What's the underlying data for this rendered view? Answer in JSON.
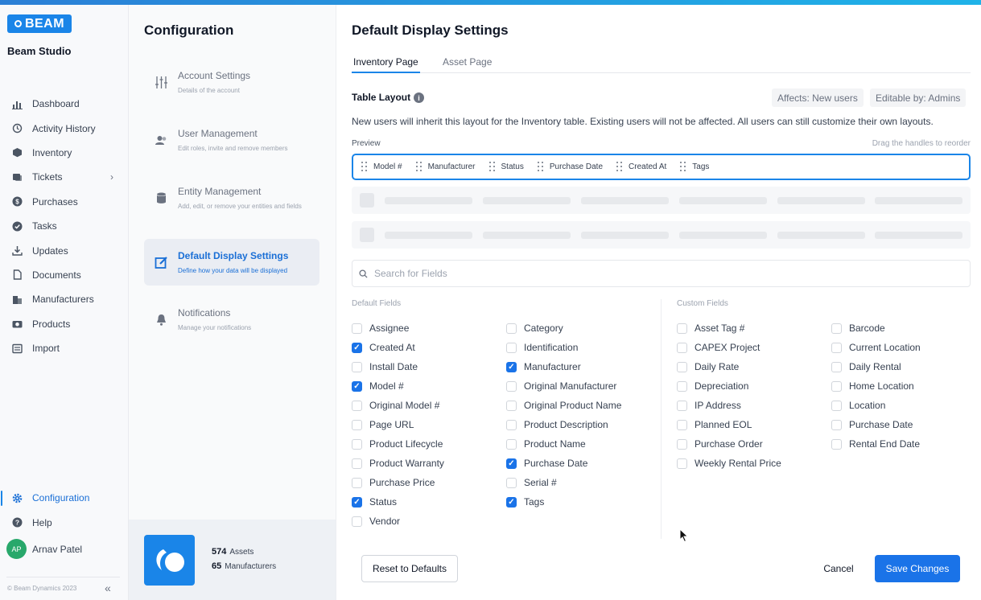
{
  "app": {
    "brand": "BEAM",
    "name": "Beam Studio",
    "accent": "#1a73e8"
  },
  "sidebar": {
    "items": [
      {
        "label": "Dashboard",
        "icon": "bar-chart-icon"
      },
      {
        "label": "Activity History",
        "icon": "history-icon"
      },
      {
        "label": "Inventory",
        "icon": "box-icon"
      },
      {
        "label": "Tickets",
        "icon": "ticket-icon"
      },
      {
        "label": "Purchases",
        "icon": "dollar-icon"
      },
      {
        "label": "Tasks",
        "icon": "check-circle-icon"
      },
      {
        "label": "Updates",
        "icon": "download-icon"
      },
      {
        "label": "Documents",
        "icon": "document-icon"
      },
      {
        "label": "Manufacturers",
        "icon": "building-icon"
      },
      {
        "label": "Products",
        "icon": "camera-icon"
      },
      {
        "label": "Import",
        "icon": "import-icon"
      }
    ],
    "bottom": [
      {
        "label": "Configuration",
        "icon": "gear-icon",
        "active": true
      },
      {
        "label": "Help",
        "icon": "help-icon"
      }
    ],
    "user": {
      "initials": "AP",
      "name": "Arnav Patel"
    },
    "copyright": "© Beam Dynamics 2023"
  },
  "config": {
    "title": "Configuration",
    "items": [
      {
        "title": "Account Settings",
        "desc": "Details of the account"
      },
      {
        "title": "User Management",
        "desc": "Edit roles, invite and remove members"
      },
      {
        "title": "Entity Management",
        "desc": "Add, edit, or remove your entities and fields"
      },
      {
        "title": "Default Display Settings",
        "desc": "Define how your data will be displayed"
      },
      {
        "title": "Notifications",
        "desc": "Manage your notifications"
      }
    ],
    "stats": [
      {
        "value": "574",
        "label": "Assets"
      },
      {
        "value": "65",
        "label": "Manufacturers"
      }
    ]
  },
  "main": {
    "title": "Default Display Settings",
    "tabs": [
      {
        "label": "Inventory Page",
        "active": true
      },
      {
        "label": "Asset Page",
        "active": false
      }
    ],
    "table_layout": {
      "title": "Table Layout",
      "affects": "Affects: New users",
      "editable": "Editable by: Admins",
      "description": "New users will inherit this layout for the Inventory table. Existing users will not be affected. All users can still customize their own layouts.",
      "preview_label": "Preview",
      "drag_hint": "Drag the handles to reorder",
      "columns": [
        "Model #",
        "Manufacturer",
        "Status",
        "Purchase Date",
        "Created At",
        "Tags"
      ]
    },
    "search": {
      "placeholder": "Search for Fields",
      "value": ""
    },
    "default_fields_label": "Default Fields",
    "custom_fields_label": "Custom Fields",
    "default_fields": {
      "col1": [
        {
          "label": "Assignee",
          "checked": false
        },
        {
          "label": "Created At",
          "checked": true
        },
        {
          "label": "Install Date",
          "checked": false
        },
        {
          "label": "Model #",
          "checked": true
        },
        {
          "label": "Original Model #",
          "checked": false
        },
        {
          "label": "Page URL",
          "checked": false
        },
        {
          "label": "Product Lifecycle",
          "checked": false
        },
        {
          "label": "Product Warranty",
          "checked": false
        },
        {
          "label": "Purchase Price",
          "checked": false
        },
        {
          "label": "Status",
          "checked": true
        },
        {
          "label": "Vendor",
          "checked": false
        }
      ],
      "col2": [
        {
          "label": "Category",
          "checked": false
        },
        {
          "label": "Identification",
          "checked": false
        },
        {
          "label": "Manufacturer",
          "checked": true
        },
        {
          "label": "Original Manufacturer",
          "checked": false
        },
        {
          "label": "Original Product Name",
          "checked": false
        },
        {
          "label": "Product Description",
          "checked": false
        },
        {
          "label": "Product Name",
          "checked": false
        },
        {
          "label": "Purchase Date",
          "checked": true
        },
        {
          "label": "Serial #",
          "checked": false
        },
        {
          "label": "Tags",
          "checked": true
        }
      ]
    },
    "custom_fields": {
      "col1": [
        {
          "label": "Asset Tag #",
          "checked": false
        },
        {
          "label": "CAPEX Project",
          "checked": false
        },
        {
          "label": "Daily Rate",
          "checked": false
        },
        {
          "label": "Depreciation",
          "checked": false
        },
        {
          "label": "IP Address",
          "checked": false
        },
        {
          "label": "Planned EOL",
          "checked": false
        },
        {
          "label": "Purchase Order",
          "checked": false
        },
        {
          "label": "Weekly Rental Price",
          "checked": false
        }
      ],
      "col2": [
        {
          "label": "Barcode",
          "checked": false
        },
        {
          "label": "Current Location",
          "checked": false
        },
        {
          "label": "Daily Rental",
          "checked": false
        },
        {
          "label": "Home Location",
          "checked": false
        },
        {
          "label": "Location",
          "checked": false
        },
        {
          "label": "Purchase Date",
          "checked": false
        },
        {
          "label": "Rental End Date",
          "checked": false
        }
      ]
    },
    "buttons": {
      "reset": "Reset to Defaults",
      "cancel": "Cancel",
      "save": "Save Changes"
    }
  }
}
